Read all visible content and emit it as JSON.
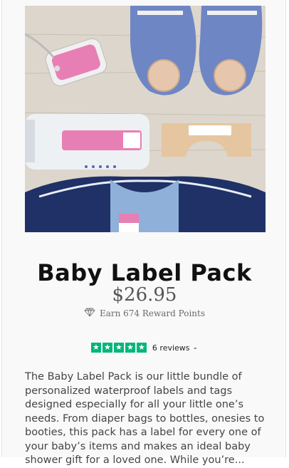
{
  "product": {
    "image_alt": "baby items with pink ballet-slipper labels",
    "title": "Baby Label Pack",
    "price": "$26.95",
    "reward_text": "Earn 674 Reward Points",
    "rating_stars": 5,
    "reviews_label": "6 reviews",
    "description": "The Baby Label Pack is our little bundle of personalized waterproof labels and tags designed especially for all your little one’s needs. From diaper bags to bottles, onesies to booties, this pack has a label for every one of your baby’s items and makes an ideal baby shower gift for a loved one. While you’re..."
  },
  "icons": {
    "reward": "diamond-icon",
    "star": "star-icon",
    "chevron": "chevron-down-icon"
  },
  "colors": {
    "trustpilot_green": "#00b67a",
    "label_pink": "#e87fb4",
    "jacket_navy": "#1f3166",
    "shoe_blue": "#6f86c4"
  }
}
